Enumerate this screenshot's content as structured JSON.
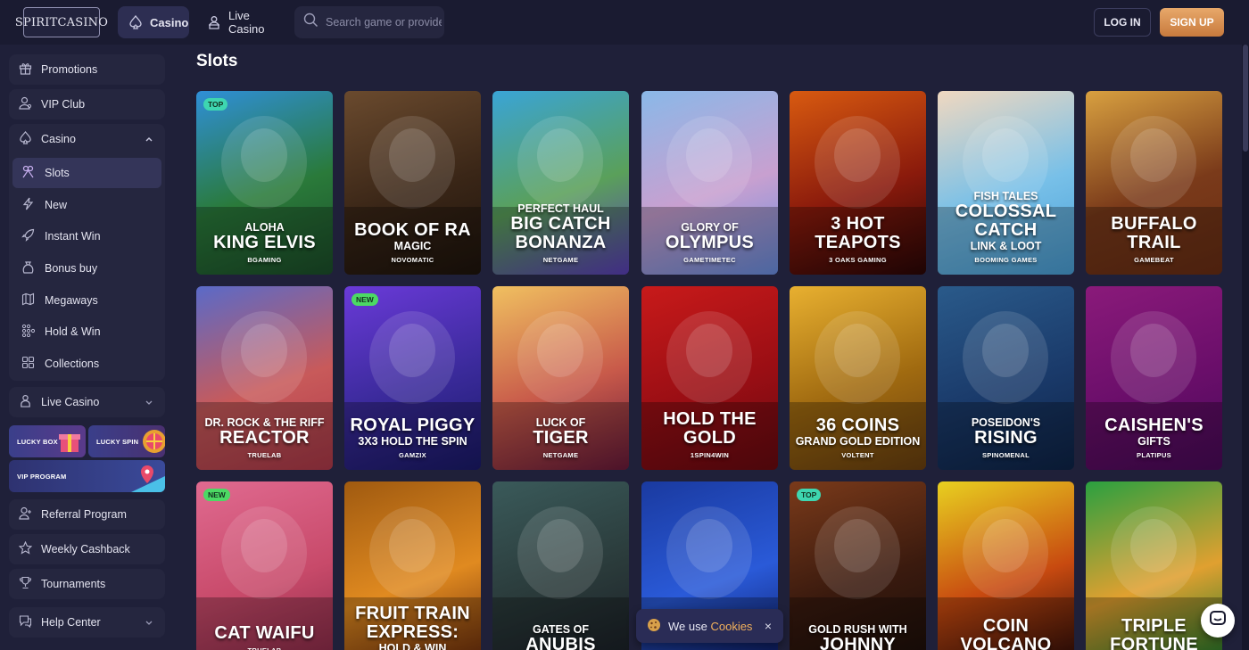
{
  "header": {
    "logo_text": "SPIRITCASINO",
    "nav": [
      {
        "label": "Casino",
        "icon": "spade-icon",
        "active": true
      },
      {
        "label": "Live Casino",
        "icon": "dealer-icon",
        "active": false
      }
    ],
    "search_placeholder": "Search game or provider",
    "login_label": "LOG IN",
    "signup_label": "SIGN UP"
  },
  "sidebar": {
    "top_items": [
      {
        "label": "Promotions",
        "icon": "gift-icon"
      },
      {
        "label": "VIP Club",
        "icon": "vip-user-icon"
      }
    ],
    "casino": {
      "label": "Casino",
      "icon": "spade-icon",
      "expanded": true,
      "items": [
        {
          "label": "Slots",
          "icon": "slots-icon",
          "active": true
        },
        {
          "label": "New",
          "icon": "lightning-icon"
        },
        {
          "label": "Instant Win",
          "icon": "rocket-icon"
        },
        {
          "label": "Bonus buy",
          "icon": "bonus-bag-icon"
        },
        {
          "label": "Megaways",
          "icon": "megaways-icon"
        },
        {
          "label": "Hold & Win",
          "icon": "dots-grid-icon"
        },
        {
          "label": "Collections",
          "icon": "collections-icon"
        }
      ]
    },
    "live_casino": {
      "label": "Live Casino",
      "icon": "dealer-icon"
    },
    "promos": [
      {
        "label": "LUCKY BOX"
      },
      {
        "label": "LUCKY SPIN"
      },
      {
        "label": "VIP PROGRAM"
      }
    ],
    "bottom_items": [
      {
        "label": "Referral Program",
        "icon": "referral-icon"
      },
      {
        "label": "Weekly Cashback",
        "icon": "star-icon"
      },
      {
        "label": "Tournaments",
        "icon": "trophy-icon"
      },
      {
        "label": "Help Center",
        "icon": "help-chat-icon"
      }
    ]
  },
  "main": {
    "title": "Slots",
    "games": [
      {
        "sub1": "ALOHA",
        "main": "KING ELVIS",
        "sub2": "",
        "provider": "BGAMING",
        "badge": "TOP",
        "colors": [
          "#2f8fd8",
          "#2a7a3a",
          "#1c4f2a"
        ]
      },
      {
        "sub1": "",
        "main": "BOOK OF RA",
        "sub2": "MAGIC",
        "provider": "NOVOMATIC",
        "badge": "",
        "colors": [
          "#6a4a2e",
          "#3a2617",
          "#1e140c"
        ]
      },
      {
        "sub1": "PERFECT HAUL",
        "main": "BIG CATCH BONANZA",
        "sub2": "",
        "provider": "NETGAME",
        "badge": "",
        "colors": [
          "#3aa4d6",
          "#5aa05a",
          "#5b3fb8"
        ]
      },
      {
        "sub1": "GLORY OF",
        "main": "OLYMPUS",
        "sub2": "",
        "provider": "GAMETIMETEC",
        "badge": "",
        "colors": [
          "#8ab8e8",
          "#c8a0d0",
          "#6a8ee0"
        ]
      },
      {
        "sub1": "",
        "main": "3 HOT TEAPOTS",
        "sub2": "",
        "provider": "3 OAKS GAMING",
        "badge": "",
        "colors": [
          "#d85a10",
          "#8a1a0c",
          "#2a0606"
        ]
      },
      {
        "sub1": "FISH TALES",
        "main": "COLOSSAL CATCH",
        "sub2": "LINK & LOOT",
        "provider": "BOOMING GAMES",
        "badge": "",
        "colors": [
          "#f0d8c0",
          "#78c0e8",
          "#4aa0d8"
        ]
      },
      {
        "sub1": "",
        "main": "BUFFALO TRAIL",
        "sub2": "",
        "provider": "GAMEBEAT",
        "badge": "",
        "colors": [
          "#d8a040",
          "#7a3a1a",
          "#6a2e14"
        ]
      },
      {
        "sub1": "DR. ROCK & THE RIFF",
        "main": "REACTOR",
        "sub2": "",
        "provider": "TRUELAB",
        "badge": "",
        "colors": [
          "#5a6ac8",
          "#c85a5a",
          "#b03a4a"
        ]
      },
      {
        "sub1": "",
        "main": "ROYAL PIGGY",
        "sub2": "3X3 HOLD THE SPIN",
        "provider": "GAMZIX",
        "badge": "NEW",
        "colors": [
          "#6a3ad8",
          "#3a2a9a",
          "#1a1a6a"
        ]
      },
      {
        "sub1": "LUCK OF",
        "main": "TIGER",
        "sub2": "",
        "provider": "NETGAME",
        "badge": "",
        "colors": [
          "#f0c060",
          "#c85a4a",
          "#6a1a3a"
        ]
      },
      {
        "sub1": "",
        "main": "HOLD THE GOLD",
        "sub2": "",
        "provider": "1SPIN4WIN",
        "badge": "",
        "colors": [
          "#c81a1a",
          "#9a0e14",
          "#6a0a10"
        ]
      },
      {
        "sub1": "",
        "main": "36 COINS",
        "sub2": "GRAND GOLD EDITION",
        "provider": "VOLTENT",
        "badge": "",
        "colors": [
          "#e8b030",
          "#a06a10",
          "#6a4010"
        ]
      },
      {
        "sub1": "POSEIDON'S",
        "main": "RISING",
        "sub2": "",
        "provider": "SPINOMENAL",
        "badge": "",
        "colors": [
          "#2a5a8a",
          "#1a3a6a",
          "#0e2448"
        ]
      },
      {
        "sub1": "",
        "main": "CAISHEN'S",
        "sub2": "GIFTS",
        "provider": "PLATIPUS",
        "badge": "",
        "colors": [
          "#8a1a7a",
          "#6a0e6a",
          "#4a0a5a"
        ]
      },
      {
        "sub1": "",
        "main": "CAT WAIFU",
        "sub2": "",
        "provider": "TRUELAB",
        "badge": "NEW",
        "colors": [
          "#e06a90",
          "#c84a6a",
          "#8a2a48"
        ]
      },
      {
        "sub1": "",
        "main": "FRUIT TRAIN EXPRESS:",
        "sub2": "HOLD & WIN",
        "provider": "",
        "badge": "",
        "colors": [
          "#a05a10",
          "#e08a20",
          "#6a2a0a"
        ]
      },
      {
        "sub1": "GATES OF",
        "main": "ANUBIS",
        "sub2": "",
        "provider": "",
        "badge": "",
        "colors": [
          "#3a5a5a",
          "#2a3a3a",
          "#1a1e26"
        ]
      },
      {
        "sub1": "",
        "main": "",
        "sub2": "",
        "provider": "",
        "badge": "",
        "colors": [
          "#1a3aa0",
          "#2a5ad8",
          "#0e1e6a"
        ]
      },
      {
        "sub1": "GOLD RUSH WITH",
        "main": "JOHNNY",
        "sub2": "",
        "provider": "",
        "badge": "TOP",
        "colors": [
          "#7a3a1a",
          "#3a1a0e",
          "#1a0e0a"
        ]
      },
      {
        "sub1": "",
        "main": "COIN VOLCANO",
        "sub2": "",
        "provider": "",
        "badge": "",
        "colors": [
          "#e8d020",
          "#c84a10",
          "#2a0a08"
        ]
      },
      {
        "sub1": "",
        "main": "TRIPLE FORTUNE",
        "sub2": "",
        "provider": "",
        "badge": "",
        "colors": [
          "#2aa040",
          "#e0a030",
          "#1a7a2a"
        ]
      }
    ]
  },
  "cookie": {
    "text": "We use",
    "link": "Cookies",
    "close": "×"
  },
  "colors": {
    "accent_orange": "#d98b4a",
    "badge_top": "#3ed6b0",
    "badge_new": "#4cd964",
    "bg": "#1f2039"
  }
}
